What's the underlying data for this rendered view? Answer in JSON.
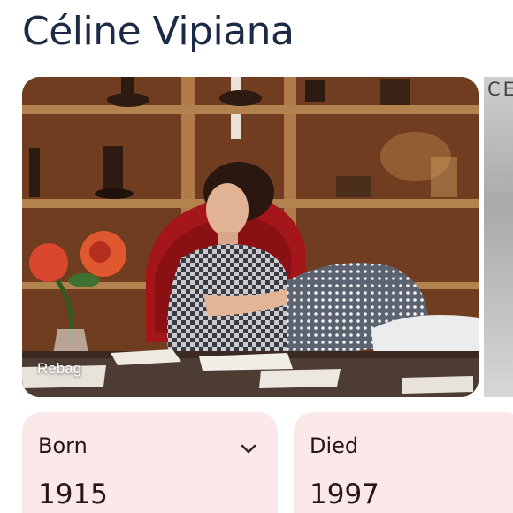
{
  "page": {
    "title": "Céline Vipiana"
  },
  "carousel": {
    "main_image": {
      "alt": "Céline Vipiana",
      "source_label": "Rebag"
    },
    "next_image": {
      "visible_text": "CE"
    }
  },
  "facts": [
    {
      "label": "Born",
      "value": "1915",
      "expand_icon": "chevron-down-icon"
    },
    {
      "label": "Died",
      "value": "1997"
    }
  ],
  "colors": {
    "title": "#1c2a45",
    "fact_card_bg": "#fbe9e9",
    "fact_text": "#2a1414"
  }
}
